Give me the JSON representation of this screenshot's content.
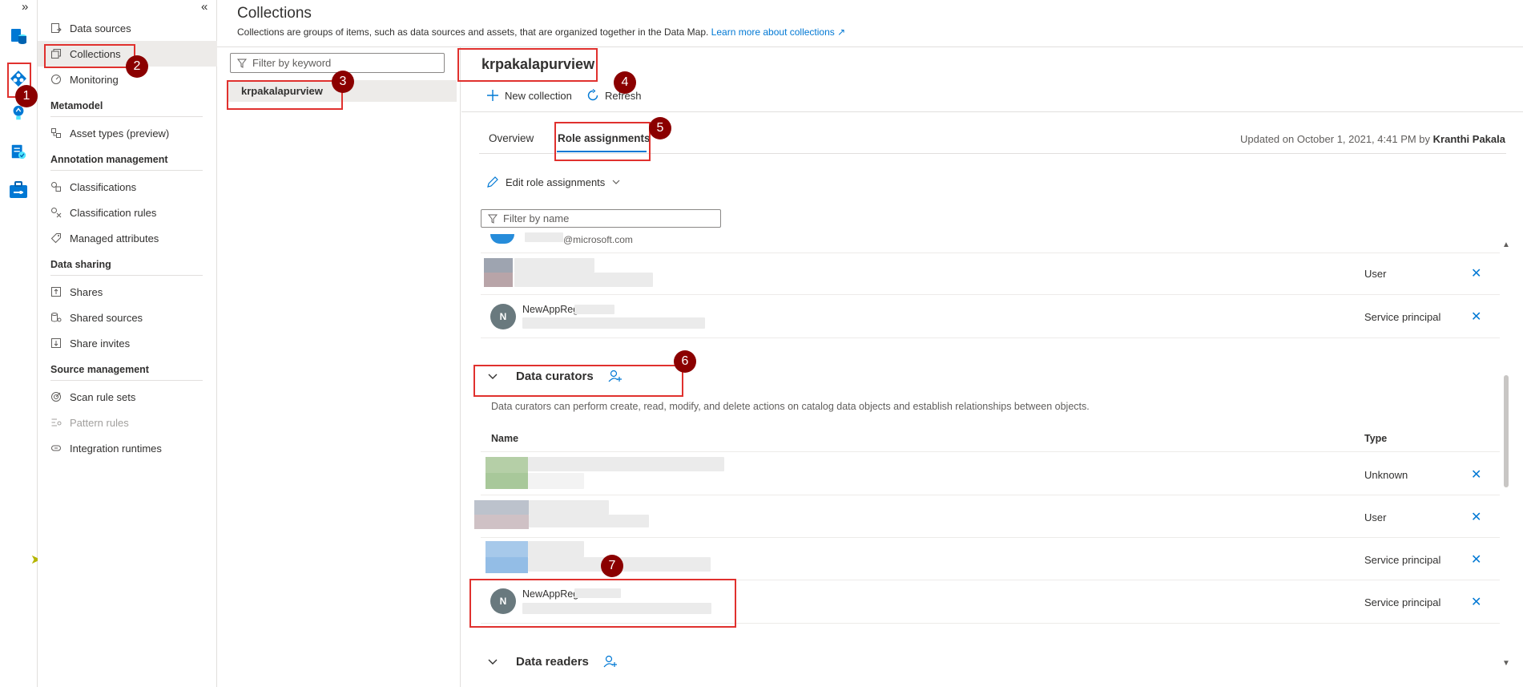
{
  "rail": {
    "collapse_glyph": "»"
  },
  "leftnav": {
    "collapse_glyph": "«",
    "items_top": [
      {
        "label": "Data sources",
        "icon": "data-source-icon"
      },
      {
        "label": "Collections",
        "icon": "collections-icon"
      },
      {
        "label": "Monitoring",
        "icon": "monitoring-icon"
      }
    ],
    "sections": [
      {
        "title": "Metamodel",
        "items": [
          {
            "label": "Asset types (preview)"
          }
        ]
      },
      {
        "title": "Annotation management",
        "items": [
          {
            "label": "Classifications"
          },
          {
            "label": "Classification rules"
          },
          {
            "label": "Managed attributes"
          }
        ]
      },
      {
        "title": "Data sharing",
        "items": [
          {
            "label": "Shares"
          },
          {
            "label": "Shared sources"
          },
          {
            "label": "Share invites"
          }
        ]
      },
      {
        "title": "Source management",
        "items": [
          {
            "label": "Scan rule sets"
          },
          {
            "label": "Pattern rules"
          },
          {
            "label": "Integration runtimes"
          }
        ]
      }
    ]
  },
  "header": {
    "title": "Collections",
    "subtitle": "Collections are groups of items, such as data sources and assets, that are organized together in the Data Map.",
    "learn_more": "Learn more about collections"
  },
  "tree": {
    "filter_placeholder": "Filter by keyword",
    "selected": "krpakalapurview"
  },
  "detail": {
    "title": "krpakalapurview",
    "toolbar": {
      "new_collection": "New collection",
      "refresh": "Refresh"
    },
    "tabs": {
      "overview": "Overview",
      "role_assignments": "Role assignments"
    },
    "updated_prefix": "Updated on October 1, 2021, 4:41 PM by",
    "updated_by": "Kranthi Pakala",
    "edit_role": "Edit role assignments",
    "filter_placeholder": "Filter by name",
    "upper_rows": [
      {
        "partial": "@microsoft.com"
      },
      {
        "type": "User"
      },
      {
        "initial": "N",
        "name": "NewAppReg",
        "type": "Service principal"
      }
    ],
    "curators": {
      "title": "Data curators",
      "description": "Data curators can perform create, read, modify, and delete actions on catalog data objects and establish relationships between objects.",
      "col_name": "Name",
      "col_type": "Type",
      "rows": [
        {
          "type": "Unknown"
        },
        {
          "type": "User"
        },
        {
          "type": "Service principal"
        },
        {
          "initial": "N",
          "name": "NewAppReg",
          "type": "Service principal"
        }
      ]
    },
    "readers": {
      "title": "Data readers"
    }
  },
  "badges": [
    "1",
    "2",
    "3",
    "4",
    "5",
    "6",
    "7"
  ],
  "colors": {
    "accent": "#0078d4",
    "annotation_red": "#e0312e",
    "badge": "#8b0000"
  }
}
